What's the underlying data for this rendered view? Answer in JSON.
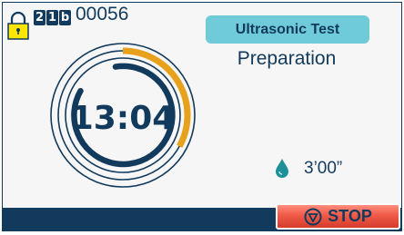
{
  "status": {
    "cycle_digits": [
      "2",
      "1",
      "b"
    ],
    "cycle_counter": "00056"
  },
  "program": {
    "tab_label": "Ultrasonic Test",
    "phase_label": "Preparation"
  },
  "timer": {
    "elapsed": "13:04",
    "progress": 0.33,
    "remaining": "3’00”"
  },
  "actions": {
    "stop_label": "STOP"
  },
  "icons": {
    "lock": "lock-icon",
    "drop": "water-drop-icon",
    "stop": "stop-icon"
  },
  "colors": {
    "navy": "#123a5c",
    "accent": "#e8a11c",
    "tab": "#6fcbd8",
    "stop": "#ef5a48"
  }
}
